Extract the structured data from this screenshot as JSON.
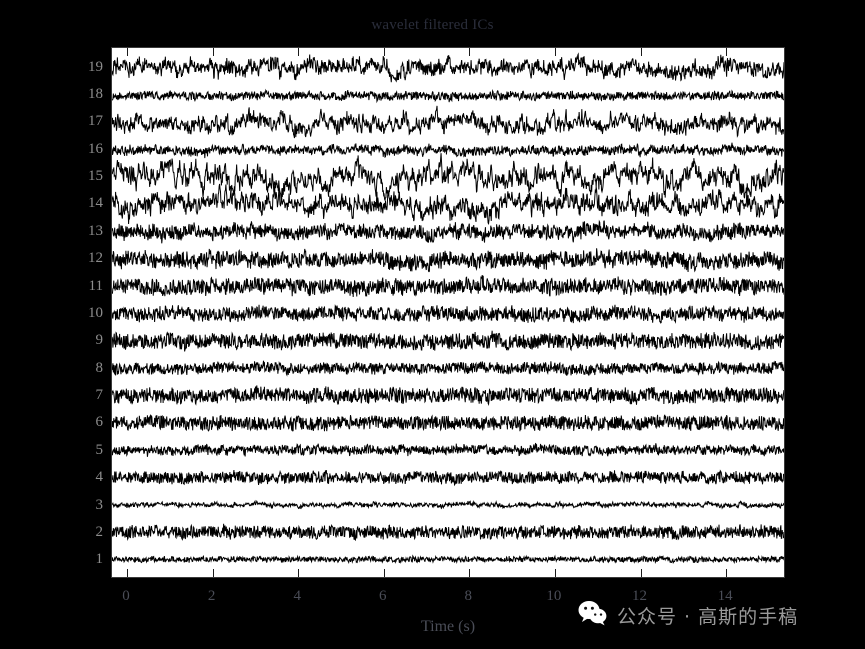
{
  "chart_data": {
    "type": "line",
    "title": "wavelet filtered ICs",
    "xlabel": "Time (s)",
    "ylabel": "",
    "xlim": [
      -0.35,
      15.4
    ],
    "ylim": [
      0.35,
      19.75
    ],
    "grid": false,
    "legend": "none",
    "xticks": [
      0,
      2,
      4,
      6,
      8,
      10,
      12,
      14
    ],
    "xtick_labels": [
      "0",
      "2",
      "4",
      "6",
      "8",
      "10",
      "12",
      "14"
    ],
    "yticks": [
      1,
      2,
      3,
      4,
      5,
      6,
      7,
      8,
      9,
      10,
      11,
      12,
      13,
      14,
      15,
      16,
      17,
      18,
      19
    ],
    "ytick_labels": [
      "1",
      "2",
      "3",
      "4",
      "5",
      "6",
      "7",
      "8",
      "9",
      "10",
      "11",
      "12",
      "13",
      "14",
      "15",
      "16",
      "17",
      "18",
      "19"
    ],
    "line_color": "#000000",
    "plot_background": "#ffffff",
    "figure_background": "#000000",
    "description": "Stacked EEG independent component time series, 19 channels, wavelet filtered broadband noise traces",
    "series": [
      {
        "name": "IC 1",
        "baseline": 1,
        "amplitude": 0.2,
        "roughness": 0.88,
        "drift": 0.05,
        "seed": 11
      },
      {
        "name": "IC 2",
        "baseline": 2,
        "amplitude": 0.46,
        "roughness": 0.92,
        "drift": 0.06,
        "seed": 23
      },
      {
        "name": "IC 3",
        "baseline": 3,
        "amplitude": 0.16,
        "roughness": 0.7,
        "drift": 0.1,
        "seed": 37
      },
      {
        "name": "IC 4",
        "baseline": 4,
        "amplitude": 0.42,
        "roughness": 0.9,
        "drift": 0.07,
        "seed": 41
      },
      {
        "name": "IC 5",
        "baseline": 5,
        "amplitude": 0.34,
        "roughness": 0.86,
        "drift": 0.07,
        "seed": 53
      },
      {
        "name": "IC 6",
        "baseline": 6,
        "amplitude": 0.5,
        "roughness": 0.93,
        "drift": 0.08,
        "seed": 67
      },
      {
        "name": "IC 7",
        "baseline": 7,
        "amplitude": 0.52,
        "roughness": 0.91,
        "drift": 0.08,
        "seed": 79
      },
      {
        "name": "IC 8",
        "baseline": 8,
        "amplitude": 0.4,
        "roughness": 0.89,
        "drift": 0.08,
        "seed": 83
      },
      {
        "name": "IC 9",
        "baseline": 9,
        "amplitude": 0.54,
        "roughness": 0.9,
        "drift": 0.09,
        "seed": 97
      },
      {
        "name": "IC 10",
        "baseline": 10,
        "amplitude": 0.5,
        "roughness": 0.88,
        "drift": 0.09,
        "seed": 101
      },
      {
        "name": "IC 11",
        "baseline": 11,
        "amplitude": 0.56,
        "roughness": 0.87,
        "drift": 0.1,
        "seed": 113
      },
      {
        "name": "IC 12",
        "baseline": 12,
        "amplitude": 0.58,
        "roughness": 0.86,
        "drift": 0.11,
        "seed": 127
      },
      {
        "name": "IC 13",
        "baseline": 13,
        "amplitude": 0.52,
        "roughness": 0.84,
        "drift": 0.12,
        "seed": 139
      },
      {
        "name": "IC 14",
        "baseline": 14,
        "amplitude": 0.62,
        "roughness": 0.55,
        "drift": 0.26,
        "seed": 149
      },
      {
        "name": "IC 15",
        "baseline": 15,
        "amplitude": 0.62,
        "roughness": 0.5,
        "drift": 0.3,
        "seed": 157
      },
      {
        "name": "IC 16",
        "baseline": 16,
        "amplitude": 0.34,
        "roughness": 0.82,
        "drift": 0.1,
        "seed": 163
      },
      {
        "name": "IC 17",
        "baseline": 17,
        "amplitude": 0.54,
        "roughness": 0.62,
        "drift": 0.22,
        "seed": 173
      },
      {
        "name": "IC 18",
        "baseline": 18,
        "amplitude": 0.3,
        "roughness": 0.88,
        "drift": 0.08,
        "seed": 181
      },
      {
        "name": "IC 19",
        "baseline": 19,
        "amplitude": 0.56,
        "roughness": 0.68,
        "drift": 0.2,
        "seed": 191
      }
    ]
  },
  "watermark": {
    "icon": "wechat-icon",
    "text": "公众号 · 高斯的手稿"
  }
}
